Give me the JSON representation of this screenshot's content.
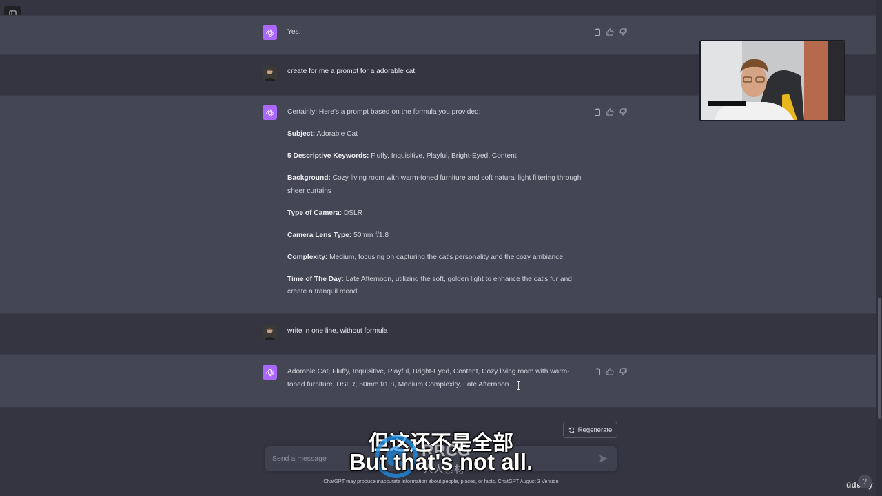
{
  "conversation": {
    "msg1": {
      "text": "Yes."
    },
    "msg2": {
      "text": "create for me a prompt for a adorable cat"
    },
    "msg3": {
      "intro": "Certainly! Here's a prompt based on the formula you provided:",
      "items": [
        {
          "label": "Subject:",
          "value": " Adorable Cat"
        },
        {
          "label": "5 Descriptive Keywords:",
          "value": " Fluffy, Inquisitive, Playful, Bright-Eyed, Content"
        },
        {
          "label": "Background:",
          "value": " Cozy living room with warm-toned furniture and soft natural light filtering through sheer curtains"
        },
        {
          "label": "Type of Camera:",
          "value": " DSLR"
        },
        {
          "label": "Camera Lens Type:",
          "value": " 50mm f/1.8"
        },
        {
          "label": "Complexity:",
          "value": " Medium, focusing on capturing the cat's personality and the cozy ambiance"
        },
        {
          "label": "Time of The Day:",
          "value": " Late Afternoon, utilizing the soft, golden light to enhance the cat's fur and create a tranquil mood."
        }
      ]
    },
    "msg4": {
      "text": "write in one line, without formula"
    },
    "msg5": {
      "text": "Adorable Cat, Fluffy, Inquisitive, Playful, Bright-Eyed, Content, Cozy living room with warm-toned furniture, DSLR, 50mm f/1.8, Medium Complexity, Late Afternoon"
    }
  },
  "composer": {
    "regenerate_label": "Regenerate",
    "placeholder": "Send a message"
  },
  "footer": {
    "disclaimer": "ChatGPT may produce inaccurate information about people, places, or facts.",
    "version_link": "ChatGPT August 3 Version"
  },
  "overlay": {
    "subtitle_cn": "但这还不是全部",
    "subtitle_en": "But that's not all.",
    "watermark_text": "RRCG",
    "watermark_sub": "人人素材",
    "brand": "ūdemy",
    "help": "?"
  },
  "colors": {
    "background": "#343541",
    "assistant_row": "#444654",
    "gpt_avatar": "#ab68ff",
    "text": "#d1d5db"
  },
  "icons": {
    "sidebar_toggle": "sidebar-toggle-icon",
    "assistant_avatar": "openai-logo-icon",
    "copy": "clipboard-icon",
    "thumbs_up": "thumbs-up-icon",
    "thumbs_down": "thumbs-down-icon",
    "regenerate": "refresh-icon",
    "send": "paper-plane-icon"
  }
}
